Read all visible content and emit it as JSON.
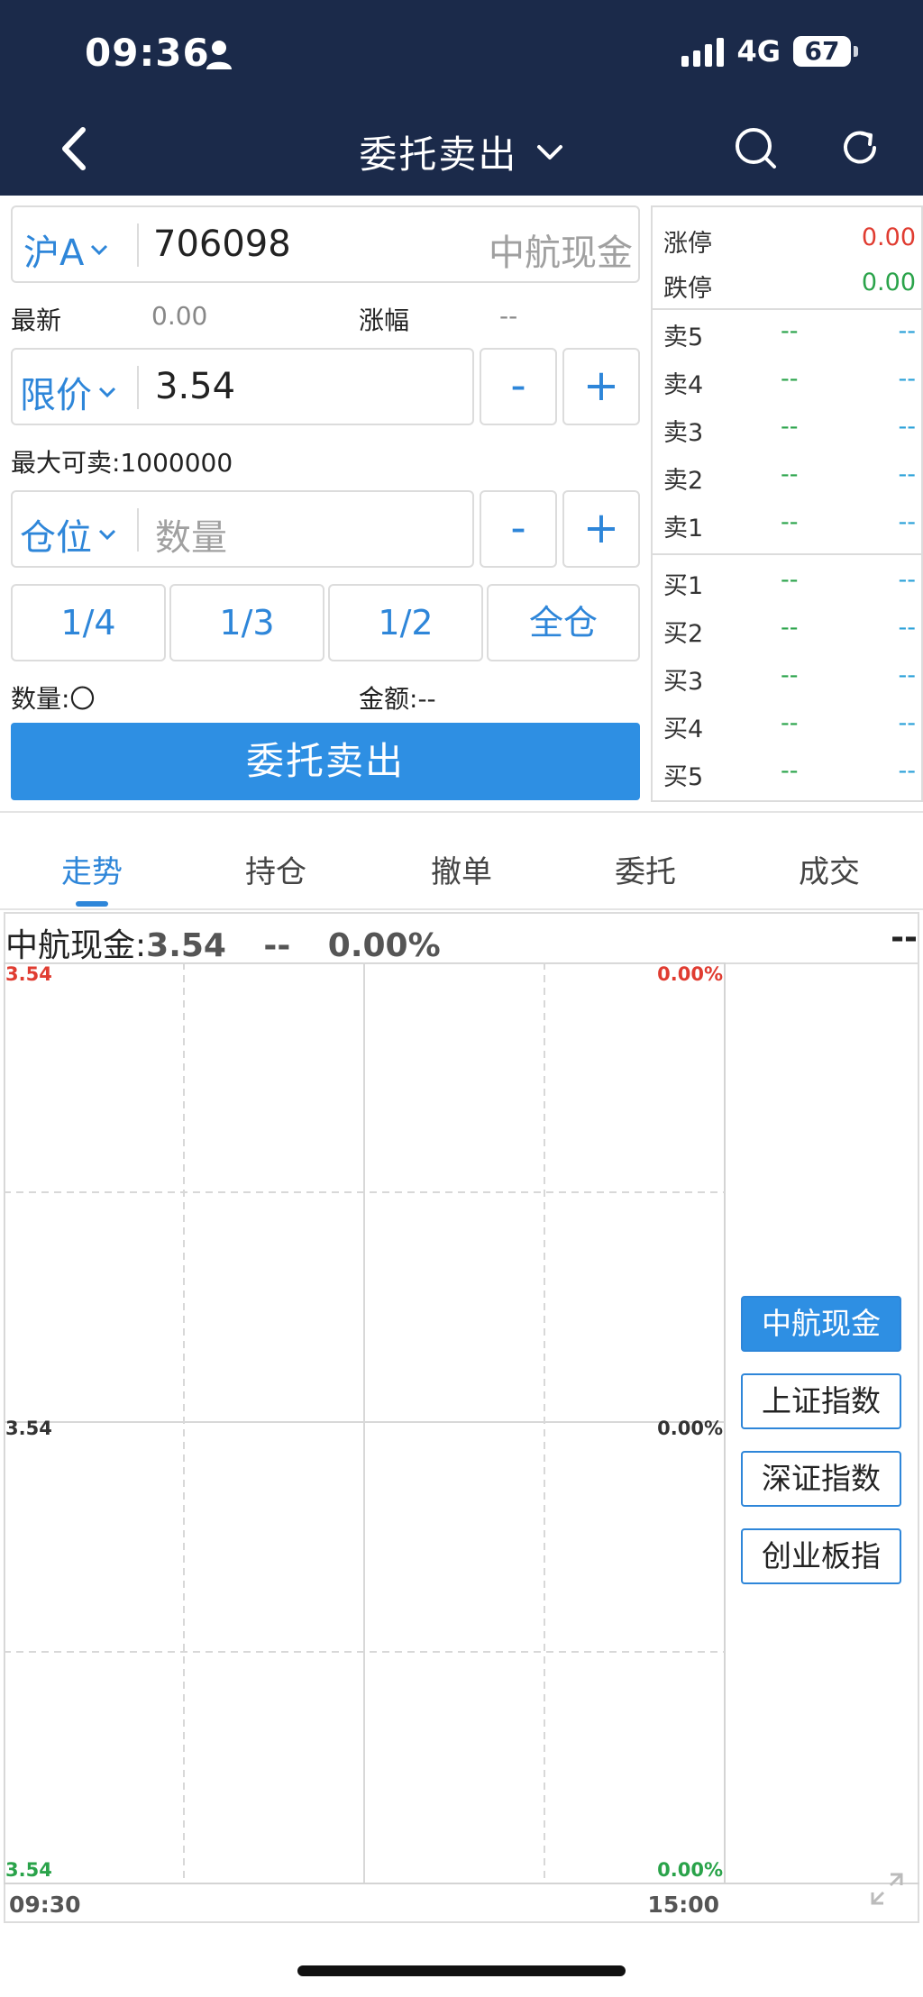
{
  "status_bar": {
    "time": "09:36",
    "network": "4G",
    "battery": "67"
  },
  "nav": {
    "title": "委托卖出"
  },
  "form": {
    "market": "沪A",
    "code": "706098",
    "stock_name": "中航现金",
    "latest_label": "最新",
    "latest_value": "0.00",
    "change_label": "涨幅",
    "change_value": "--",
    "price_type": "限价",
    "price": "3.54",
    "minus": "-",
    "plus": "+",
    "max_sell": "最大可卖:1000000",
    "position_type": "仓位",
    "qty_placeholder": "数量",
    "ratios": [
      "1/4",
      "1/3",
      "1/2",
      "全仓"
    ],
    "qty_label": "数量:",
    "qty_value": "〇",
    "amount_label": "金额:",
    "amount_value": "--",
    "submit": "委托卖出"
  },
  "order_book": {
    "limit_up_label": "涨停",
    "limit_up": "0.00",
    "limit_down_label": "跌停",
    "limit_down": "0.00",
    "sells": [
      {
        "label": "卖5",
        "price": "--",
        "volume": "--"
      },
      {
        "label": "卖4",
        "price": "--",
        "volume": "--"
      },
      {
        "label": "卖3",
        "price": "--",
        "volume": "--"
      },
      {
        "label": "卖2",
        "price": "--",
        "volume": "--"
      },
      {
        "label": "卖1",
        "price": "--",
        "volume": "--"
      }
    ],
    "buys": [
      {
        "label": "买1",
        "price": "--",
        "volume": "--"
      },
      {
        "label": "买2",
        "price": "--",
        "volume": "--"
      },
      {
        "label": "买3",
        "price": "--",
        "volume": "--"
      },
      {
        "label": "买4",
        "price": "--",
        "volume": "--"
      },
      {
        "label": "买5",
        "price": "--",
        "volume": "--"
      }
    ]
  },
  "tabs": [
    "走势",
    "持仓",
    "撤单",
    "委托",
    "成交"
  ],
  "chart": {
    "header_name": "中航现金:",
    "header_price": "3.54",
    "header_change": "--",
    "header_pct": "0.00%",
    "header_right": "--",
    "y_top": "3.54",
    "y_mid": "3.54",
    "y_bottom": "3.54",
    "pct_top": "0.00%",
    "pct_mid": "0.00%",
    "pct_bottom": "0.00%",
    "x_start": "09:30",
    "x_end": "15:00",
    "index_buttons": [
      "中航现金",
      "上证指数",
      "深证指数",
      "创业板指"
    ]
  },
  "colors": {
    "header_bg": "#1b2a4a",
    "accent": "#2e86d9",
    "up": "#e03c31",
    "down": "#2aa34a"
  }
}
